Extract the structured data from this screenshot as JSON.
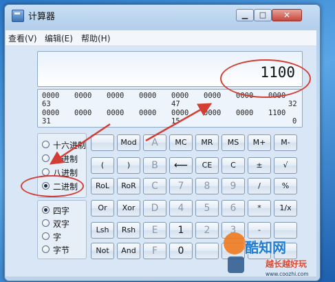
{
  "window": {
    "title": "计算器"
  },
  "menu": [
    "查看(V)",
    "编辑(E)",
    "帮助(H)"
  ],
  "display": {
    "value": "1100"
  },
  "bits": {
    "row1": [
      "0000",
      "0000",
      "0000",
      "0000",
      "0000",
      "0000",
      "0000",
      "0000"
    ],
    "row1_labels": [
      "63",
      "47",
      "32"
    ],
    "row2": [
      "0000",
      "0000",
      "0000",
      "0000",
      "0000",
      "0000",
      "0000",
      "1100"
    ],
    "row2_labels": [
      "31",
      "15",
      "0"
    ]
  },
  "radix": [
    "十六进制",
    "十进制",
    "八进制",
    "二进制"
  ],
  "radix_selected": "二进制",
  "wordsize": [
    "四字",
    "双字",
    "字",
    "字节"
  ],
  "wordsize_selected": "四字",
  "keys": {
    "row1": [
      "",
      "Mod",
      "A",
      "MC",
      "MR",
      "MS",
      "M+",
      "M-"
    ],
    "row2": [
      "(",
      ")",
      "B",
      "⟵",
      "CE",
      "C",
      "±",
      "√"
    ],
    "row3": [
      "RoL",
      "RoR",
      "C",
      "7",
      "8",
      "9",
      "/",
      "%"
    ],
    "row4": [
      "Or",
      "Xor",
      "D",
      "4",
      "5",
      "6",
      "*",
      "1/x"
    ],
    "row5": [
      "Lsh",
      "Rsh",
      "E",
      "1",
      "2",
      "3",
      "-",
      ""
    ],
    "row6": [
      "Not",
      "And",
      "F",
      "0",
      "",
      "",
      "",
      " "
    ]
  },
  "watermark": {
    "title": "酷知网",
    "subtitle": "越长越好玩",
    "url": "www.coozhi.com"
  },
  "colors": {
    "annotation": "#d43d33",
    "window_bg": "#d9e6f5"
  }
}
